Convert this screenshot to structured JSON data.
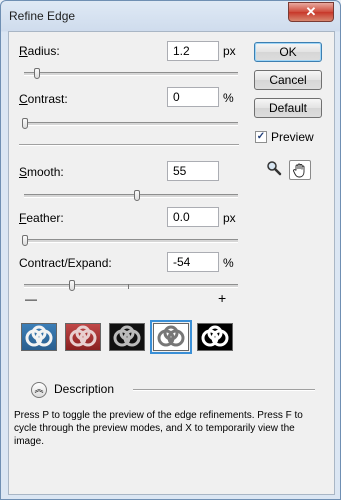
{
  "window": {
    "title": "Refine Edge",
    "close_glyph": "✕"
  },
  "controls": {
    "radius": {
      "label_pre": "",
      "label_u": "R",
      "label_post": "adius:",
      "value": "1.2",
      "unit": "px",
      "level": 0.04
    },
    "contrast": {
      "label_pre": "",
      "label_u": "C",
      "label_post": "ontrast:",
      "value": "0",
      "unit": "%",
      "level": 0.0
    },
    "smooth": {
      "label_pre": "",
      "label_u": "S",
      "label_post": "mooth:",
      "value": "55",
      "unit": "",
      "level": 0.55
    },
    "feather": {
      "label_pre": "",
      "label_u": "F",
      "label_post": "eather:",
      "value": "0.0",
      "unit": "px",
      "level": 0.0
    },
    "contract": {
      "label_pre": "",
      "label_u": "",
      "label_post": "Contract/Expand:",
      "value": "-54",
      "unit": "%",
      "level": 0.23
    },
    "minus": "—",
    "plus": "+"
  },
  "buttons": {
    "ok": "OK",
    "cancel": "Cancel",
    "default": "Default"
  },
  "preview": {
    "label": "Preview",
    "checked": true,
    "check_glyph": "✓"
  },
  "tools": {
    "zoom_icon": "zoom-icon",
    "hand_icon": "hand-icon"
  },
  "thumbnails": [
    {
      "name": "standard",
      "bg": "#2c6a9a"
    },
    {
      "name": "quick-mask",
      "bg": "#a52a2a"
    },
    {
      "name": "on-black",
      "bg": "#111111"
    },
    {
      "name": "on-white",
      "bg": "#ffffff"
    },
    {
      "name": "mask",
      "bg": "#000000"
    }
  ],
  "description": {
    "title": "Description",
    "text": "Press P to toggle the preview of the edge refinements. Press F to cycle through the preview modes, and X to temporarily view the image."
  }
}
